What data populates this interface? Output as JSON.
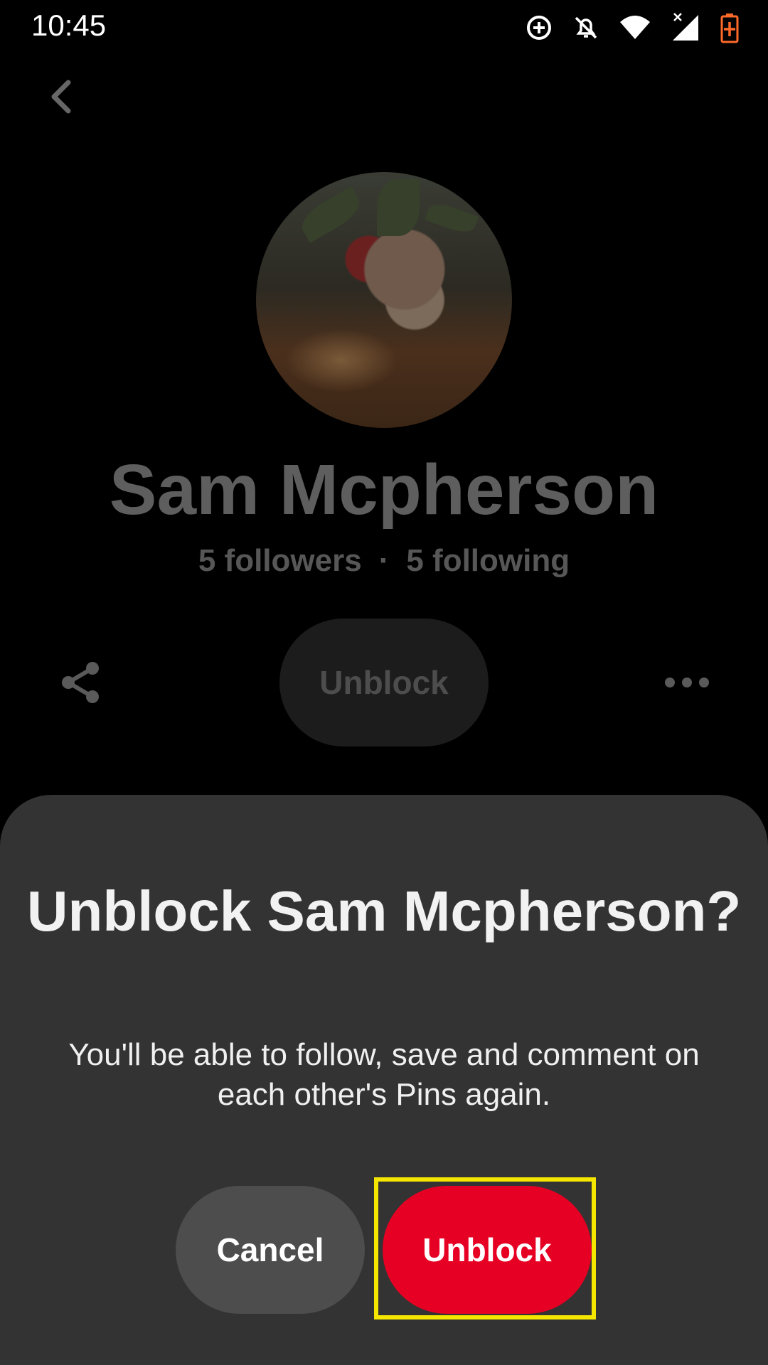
{
  "status_bar": {
    "time": "10:45",
    "icons": [
      "data-saver-icon",
      "notifications-off-icon",
      "wifi-icon",
      "signal-icon",
      "battery-charging-icon"
    ]
  },
  "header": {
    "back_icon": "chevron-left-icon"
  },
  "profile": {
    "name": "Sam Mcpherson",
    "followers": "5 followers",
    "separator": "·",
    "following": "5 following",
    "unblock_label": "Unblock",
    "share_icon": "share-icon",
    "more_icon": "more-horizontal-icon"
  },
  "dialog": {
    "title": "Unblock Sam Mcpherson?",
    "body": "You'll be able to follow, save and comment on each other's Pins again.",
    "cancel_label": "Cancel",
    "confirm_label": "Unblock"
  },
  "colors": {
    "accent": "#e60023",
    "sheet": "#333333",
    "highlight": "#f5e600"
  }
}
